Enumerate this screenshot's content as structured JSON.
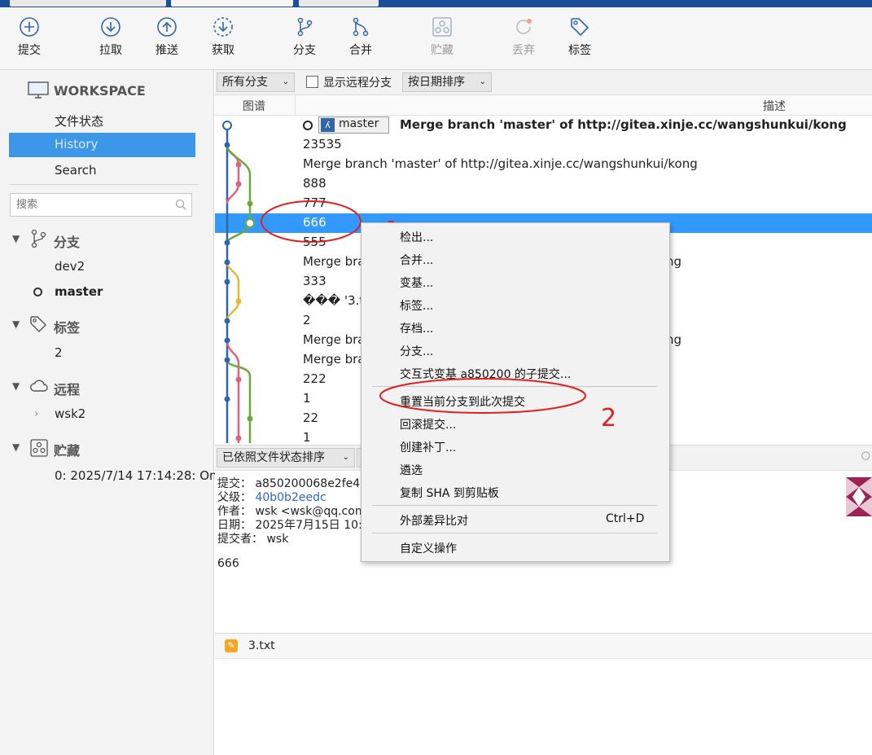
{
  "toolbar": {
    "commit": "提交",
    "pull": "拉取",
    "push": "推送",
    "fetch": "获取",
    "branch": "分支",
    "merge": "合并",
    "stash": "贮藏",
    "discard": "丢弃",
    "tag": "标签"
  },
  "sidebar": {
    "workspace": "WORKSPACE",
    "file_status": "文件状态",
    "history": "History",
    "search": "Search",
    "search_placeholder": "搜索",
    "branches_header": "分支",
    "branches": [
      "dev2",
      "master"
    ],
    "tags_header": "标签",
    "tags": [
      "2"
    ],
    "remotes_header": "远程",
    "remotes": [
      "wsk2"
    ],
    "stashes_header": "贮藏",
    "stashes": [
      "0: 2025/7/14 17:14:28: On"
    ]
  },
  "filters": {
    "all_branches": "所有分支",
    "show_remote": "显示远程分支",
    "sort_by_date": "按日期排序"
  },
  "columns": {
    "graph": "图谱",
    "description": "描述"
  },
  "branch_label": "master",
  "commits": [
    "Merge branch 'master' of http://gitea.xinje.cc/wangshunkui/kong",
    "23535",
    "Merge branch 'master' of http://gitea.xinje.cc/wangshunkui/kong",
    "888",
    "777",
    "666",
    "555",
    "Merge bra",
    "ng",
    "333",
    "��� '3.tx",
    "2",
    "Merge bra",
    "ng",
    "Merge bra",
    "222",
    "1",
    "22",
    "1"
  ],
  "detail": {
    "sort_label": "已依照文件状态排序",
    "commit_key": "提交：",
    "commit_val": "a850200068e2fe42",
    "parent_key": "父级：",
    "parent_val": "40b0b2eedc",
    "author_key": "作者：",
    "author_val": "wsk <wsk@qq.com",
    "date_key": "日期：",
    "date_val": "2025年7月15日 10:",
    "committer_key": "提交者：",
    "committer_val": "wsk",
    "message": "666",
    "file": "3.txt"
  },
  "context_menu": {
    "checkout": "检出...",
    "merge": "合并...",
    "rebase": "变基...",
    "tag": "标签...",
    "archive": "存档...",
    "branch": "分支...",
    "interactive_rebase": "交互式变基 a850200 的子提交...",
    "reset": "重置当前分支到此次提交",
    "revert": "回滚提交...",
    "patch": "创建补丁...",
    "cherry_pick": "遴选",
    "copy_sha": "复制 SHA 到剪贴板",
    "external_diff": "外部差异比对",
    "external_diff_shortcut": "Ctrl+D",
    "custom_actions": "自定义操作"
  },
  "annotations": {
    "mark1": "1",
    "mark2": "2"
  },
  "colors": {
    "selection": "#3399ff",
    "sidebar_selection": "#3c97e8",
    "annotation": "#e02020",
    "blue_line": "#2e66a6",
    "pink_line": "#e06080",
    "green_line": "#6aaa3a",
    "yellow_line": "#e6b83a"
  }
}
